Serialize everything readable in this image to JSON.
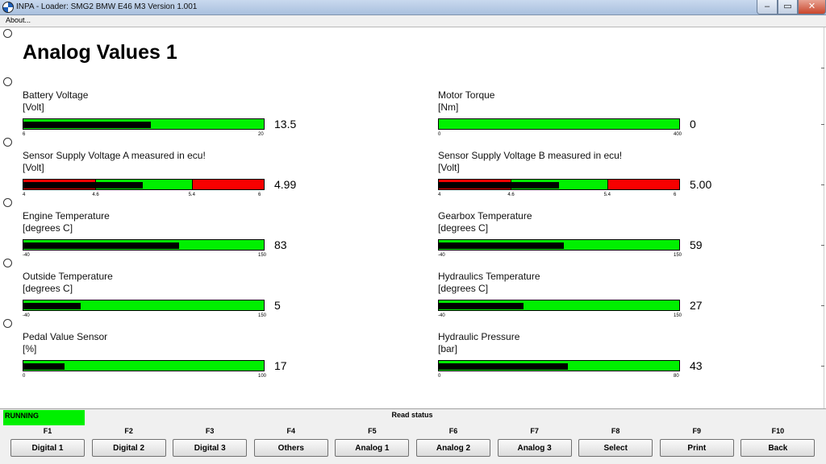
{
  "window": {
    "title": "INPA - Loader:  SMG2 BMW E46 M3 Version 1.001",
    "minimize": "–",
    "maximize": "▭",
    "close": "✕"
  },
  "menu": {
    "about": "About..."
  },
  "page": {
    "title": "Analog Values 1"
  },
  "measures": [
    {
      "label": "Battery Voltage",
      "unit": "[Volt]",
      "value": "13.5",
      "ticks": [
        "6",
        "20"
      ],
      "fill_fraction": 0.53,
      "red_zones": [],
      "dividers": []
    },
    {
      "label": "Motor Torque",
      "unit": "[Nm]",
      "value": "0",
      "ticks": [
        "0",
        "400"
      ],
      "fill_fraction": 0.0,
      "red_zones": [],
      "dividers": []
    },
    {
      "label": "Sensor Supply Voltage A  measured in ecu!",
      "unit": "[Volt]",
      "value": "4.99",
      "ticks": [
        "4",
        "4.6",
        "5.4",
        "6"
      ],
      "fill_fraction": 0.495,
      "red_zones": [
        [
          0,
          0.3
        ],
        [
          0.7,
          1.0
        ]
      ],
      "dividers": [
        0.3,
        0.7
      ]
    },
    {
      "label": "Sensor Supply Voltage B  measured in ecu!",
      "unit": "[Volt]",
      "value": "5.00",
      "ticks": [
        "4",
        "4.6",
        "5.4",
        "6"
      ],
      "fill_fraction": 0.5,
      "red_zones": [
        [
          0,
          0.3
        ],
        [
          0.7,
          1.0
        ]
      ],
      "dividers": [
        0.3,
        0.7
      ]
    },
    {
      "label": "Engine Temperature",
      "unit": "[degrees C]",
      "value": "83",
      "ticks": [
        "-40",
        "150"
      ],
      "fill_fraction": 0.647,
      "red_zones": [],
      "dividers": []
    },
    {
      "label": "Gearbox Temperature",
      "unit": "[degrees C]",
      "value": "59",
      "ticks": [
        "-40",
        "150"
      ],
      "fill_fraction": 0.521,
      "red_zones": [],
      "dividers": []
    },
    {
      "label": "Outside Temperature",
      "unit": "[degrees C]",
      "value": "5",
      "ticks": [
        "-40",
        "150"
      ],
      "fill_fraction": 0.237,
      "red_zones": [],
      "dividers": []
    },
    {
      "label": "Hydraulics Temperature",
      "unit": "[degrees C]",
      "value": "27",
      "ticks": [
        "-40",
        "150"
      ],
      "fill_fraction": 0.353,
      "red_zones": [],
      "dividers": []
    },
    {
      "label": "Pedal Value Sensor",
      "unit": "[%]",
      "value": "17",
      "ticks": [
        "0",
        "100"
      ],
      "fill_fraction": 0.17,
      "red_zones": [],
      "dividers": []
    },
    {
      "label": "Hydraulic Pressure",
      "unit": "[bar]",
      "value": "43",
      "ticks": [
        "0",
        "80"
      ],
      "fill_fraction": 0.5375,
      "red_zones": [],
      "dividers": []
    }
  ],
  "status": {
    "running": "RUNNING",
    "read_status": "Read status"
  },
  "fkeys": [
    {
      "key": "F1",
      "label": "Digital 1"
    },
    {
      "key": "F2",
      "label": "Digital 2"
    },
    {
      "key": "F3",
      "label": "Digital 3"
    },
    {
      "key": "F4",
      "label": "Others"
    },
    {
      "key": "F5",
      "label": "Analog 1"
    },
    {
      "key": "F6",
      "label": "Analog 2"
    },
    {
      "key": "F7",
      "label": "Analog 3"
    },
    {
      "key": "F8",
      "label": "Select"
    },
    {
      "key": "F9",
      "label": "Print"
    },
    {
      "key": "F10",
      "label": "Back"
    }
  ],
  "colors": {
    "bar_green": "#00f000",
    "bar_red": "#f70000",
    "bar_fill": "#000000",
    "running_green": "#00f000"
  }
}
